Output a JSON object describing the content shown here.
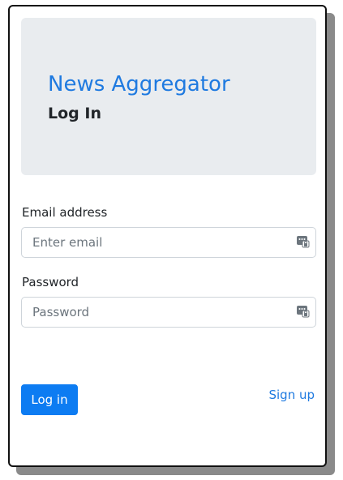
{
  "header": {
    "app_title": "News Aggregator",
    "page_heading": "Log In"
  },
  "form": {
    "email": {
      "label": "Email address",
      "placeholder": "Enter email",
      "value": ""
    },
    "password": {
      "label": "Password",
      "placeholder": "Password",
      "value": ""
    },
    "submit_label": "Log in",
    "signup_label": "Sign up"
  },
  "icons": {
    "field_autofill": "password-manager-icon"
  },
  "colors": {
    "brand": "#1f7ae0",
    "primary_button": "#0d7cf2",
    "jumbotron_bg": "#e9ecef",
    "card_shadow": "#8a8a8a"
  }
}
